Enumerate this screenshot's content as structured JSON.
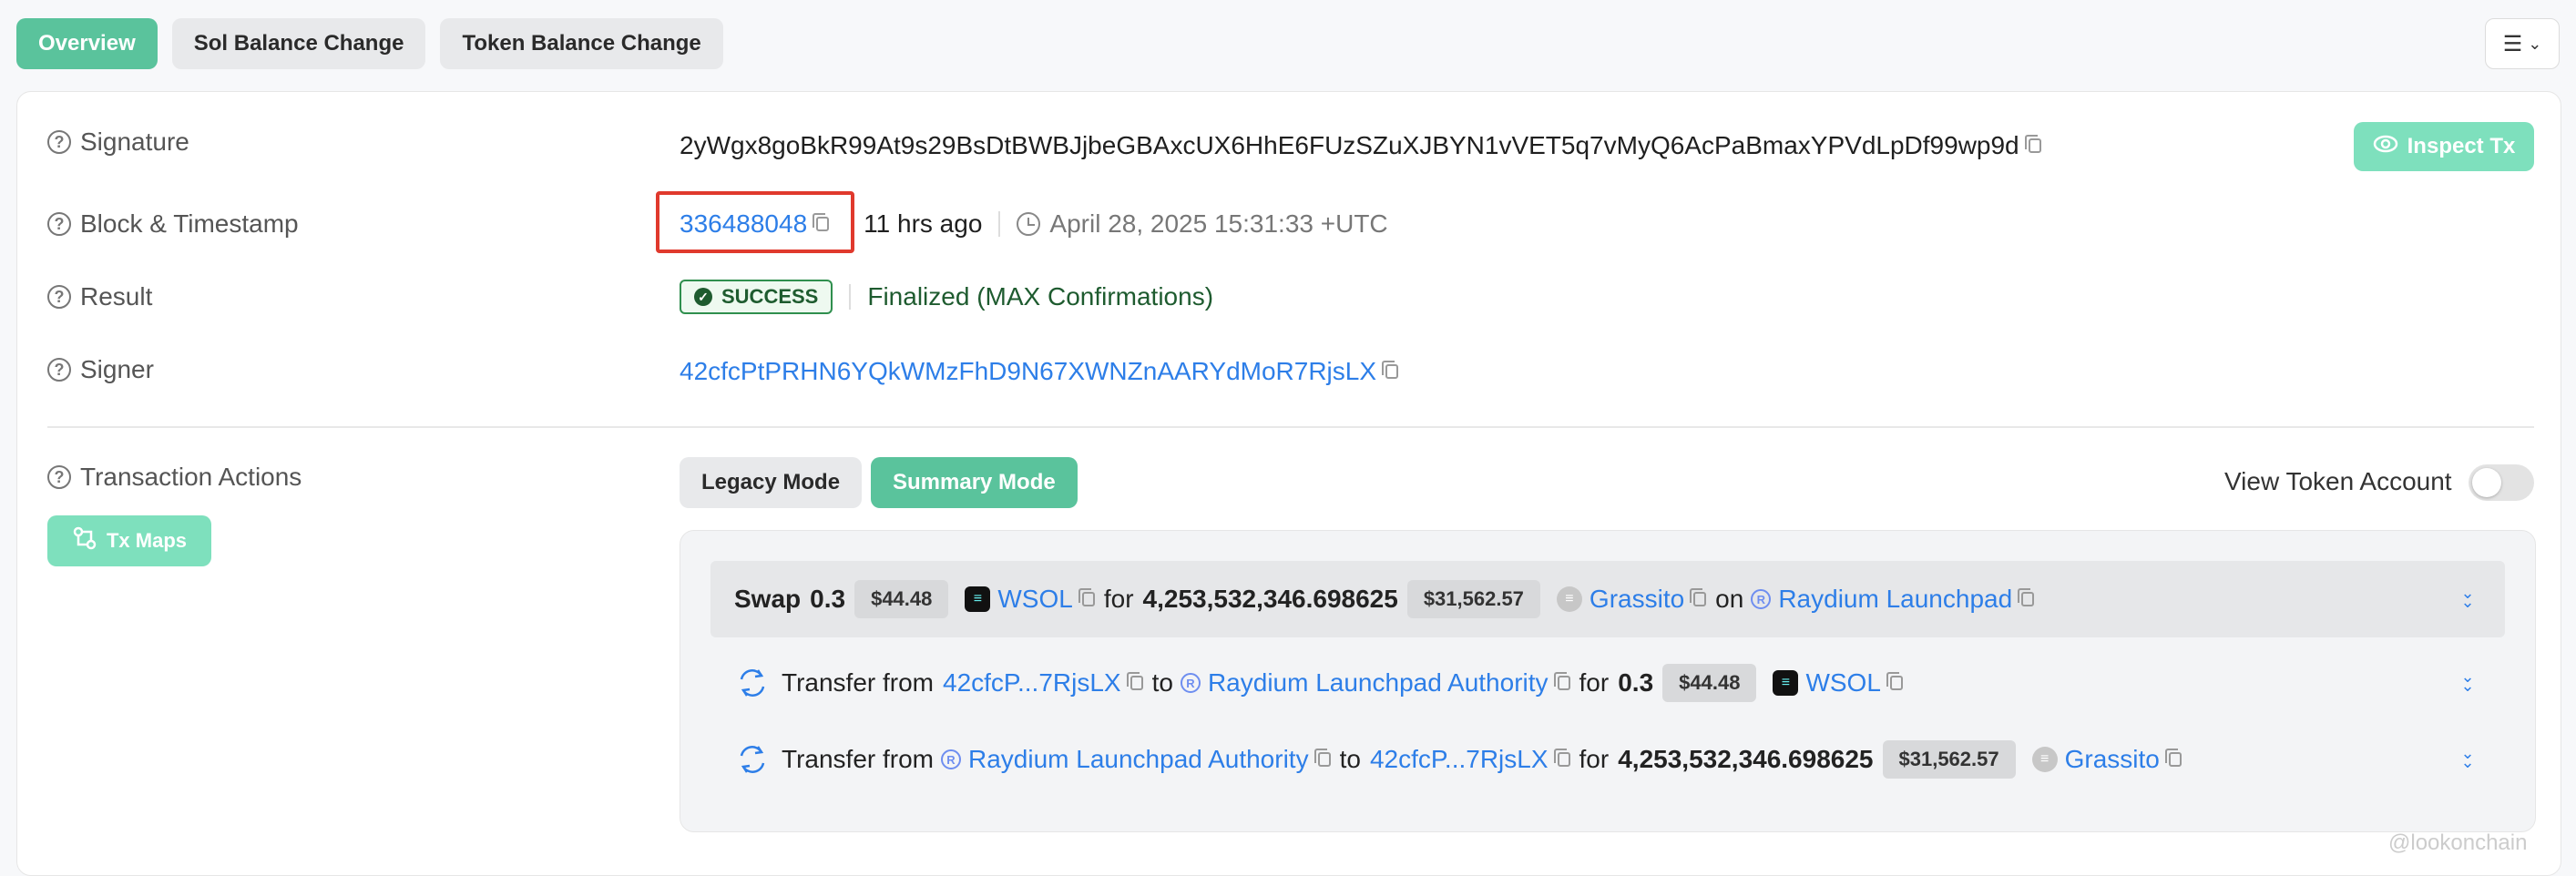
{
  "tabs": [
    "Overview",
    "Sol Balance Change",
    "Token Balance Change"
  ],
  "signature": {
    "label": "Signature",
    "value": "2yWgx8goBkR99At9s29BsDtBWBJjbeGBAxcUX6HhE6FUzSZuXJBYN1vVET5q7vMyQ6AcPaBmaxYPVdLpDf99wp9d",
    "inspect_label": "Inspect Tx"
  },
  "block": {
    "label": "Block & Timestamp",
    "number": "336488048",
    "relative": "11 hrs ago",
    "timestamp": "April 28, 2025 15:31:33 +UTC"
  },
  "result": {
    "label": "Result",
    "status": "SUCCESS",
    "finality": "Finalized (MAX Confirmations)"
  },
  "signer": {
    "label": "Signer",
    "address": "42cfcPtPRHN6YQkWMzFhD9N67XWNZnAARYdMoR7RjsLX"
  },
  "actions": {
    "label": "Transaction Actions",
    "tx_maps_label": "Tx Maps",
    "legacy_label": "Legacy Mode",
    "summary_label": "Summary Mode",
    "view_token_label": "View Token Account",
    "swap": {
      "verb": "Swap",
      "amount_in": "0.3",
      "usd_in": "$44.48",
      "token_in": "WSOL",
      "for": "for",
      "amount_out": "4,253,532,346.698625",
      "usd_out": "$31,562.57",
      "token_out": "Grassito",
      "on": "on",
      "platform": "Raydium Launchpad"
    },
    "transfer1": {
      "prefix": "Transfer from",
      "from": "42cfcP...7RjsLX",
      "to_word": "to",
      "to": "Raydium Launchpad Authority",
      "for": "for",
      "amount": "0.3",
      "usd": "$44.48",
      "token": "WSOL"
    },
    "transfer2": {
      "prefix": "Transfer from",
      "from": "Raydium Launchpad Authority",
      "to_word": "to",
      "to": "42cfcP...7RjsLX",
      "for": "for",
      "amount": "4,253,532,346.698625",
      "usd": "$31,562.57",
      "token": "Grassito"
    }
  },
  "watermark": "@lookonchain"
}
